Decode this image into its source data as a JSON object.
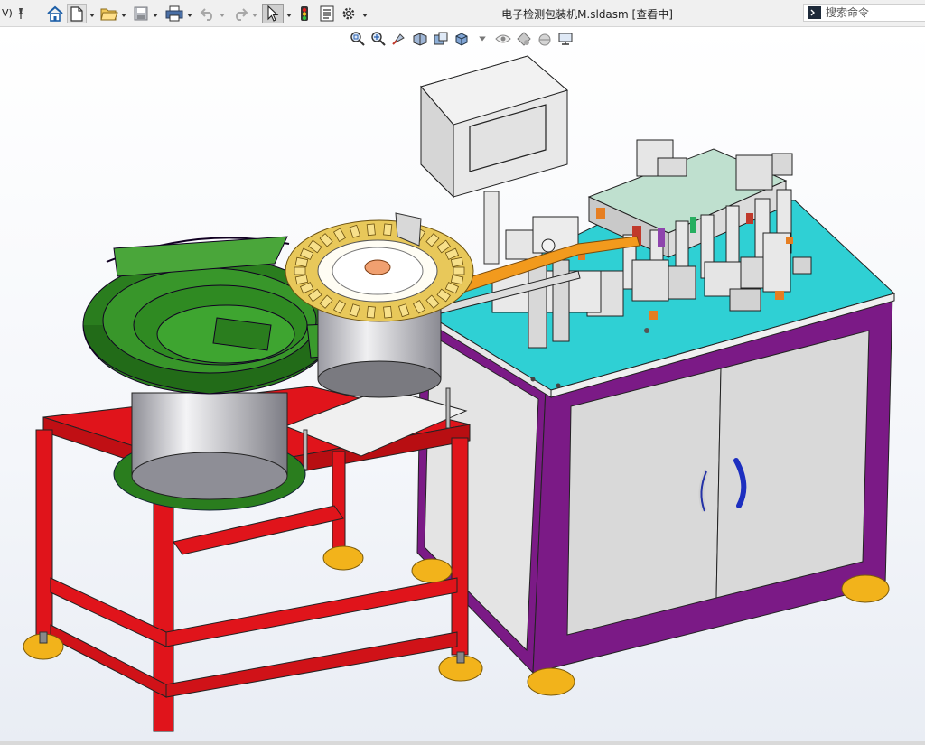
{
  "window": {
    "menu_stub": "V)",
    "title": "电子检测包装机M.sldasm [查看中]"
  },
  "search": {
    "placeholder": "搜索命令"
  },
  "toolbar": {
    "items": [
      "pin-icon",
      "home-icon",
      "new-document-icon",
      "open-icon",
      "save-icon",
      "print-icon",
      "undo-icon",
      "redo-icon",
      "select-pointer-icon",
      "traffic-light-icon",
      "file-properties-icon",
      "options-gear-icon"
    ]
  },
  "heads_up_toolbar": {
    "items": [
      "zoom-to-fit-icon",
      "zoom-area-icon",
      "previous-view-icon",
      "section-view-icon",
      "dynamic-annotation-icon",
      "view-orientation-icon",
      "display-style-icon",
      "hide-show-icon",
      "appearance-icon",
      "scene-icon",
      "display-settings-icon"
    ]
  },
  "colors": {
    "frame_red": "#e0141b",
    "bowl_green": "#2a7d1e",
    "cabinet_purple": "#7b1a86",
    "tabletop_cyan": "#2fd0d4",
    "door_gray": "#d8d8d8",
    "foot_yellow": "#f2b31b",
    "tray_gold": "#e8c85a"
  }
}
